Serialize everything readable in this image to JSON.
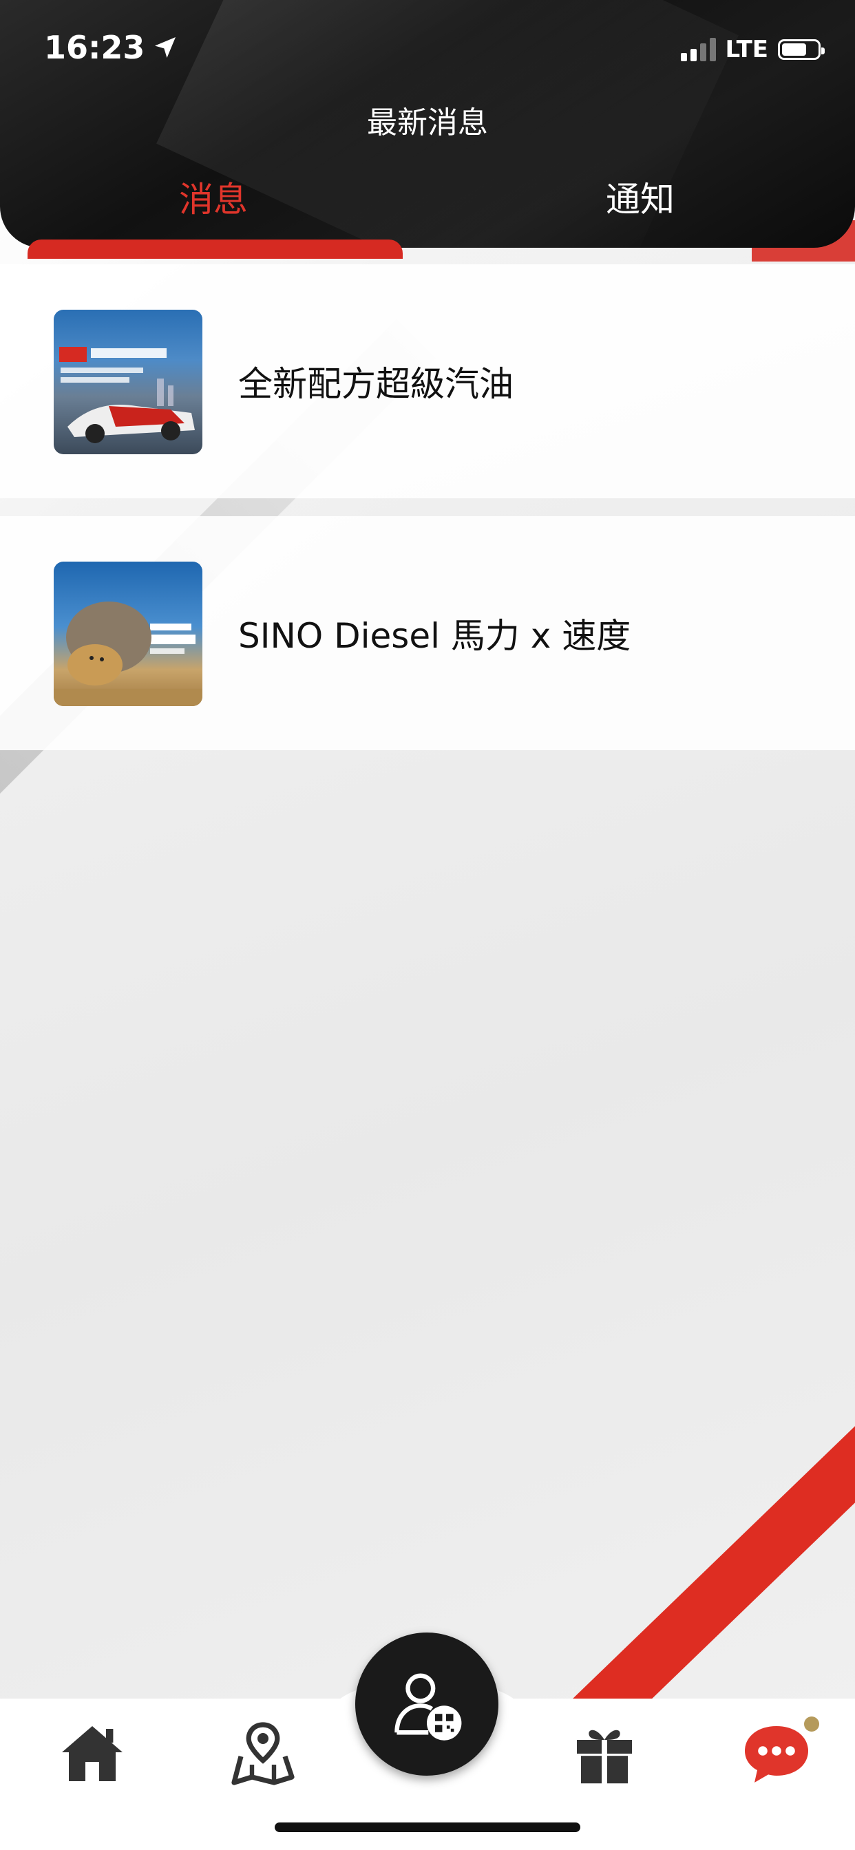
{
  "status_bar": {
    "time": "16:23",
    "network": "LTE"
  },
  "header": {
    "title": "最新消息"
  },
  "tabs": [
    {
      "label": "消息",
      "active": true
    },
    {
      "label": "通知",
      "active": false
    }
  ],
  "messages": [
    {
      "title": "全新配方超級汽油",
      "thumb_icon": "race-car-promo-image"
    },
    {
      "title": "SINO Diesel 馬力 x 速度",
      "thumb_icon": "elephant-cheetah-promo-image"
    }
  ],
  "bottom_nav": {
    "items": [
      "home-icon",
      "map-icon",
      "member-qr-icon",
      "gift-icon",
      "chat-icon"
    ]
  },
  "colors": {
    "accent": "#d62a22",
    "header_bg": "#111111",
    "badge": "#b59a5b"
  }
}
